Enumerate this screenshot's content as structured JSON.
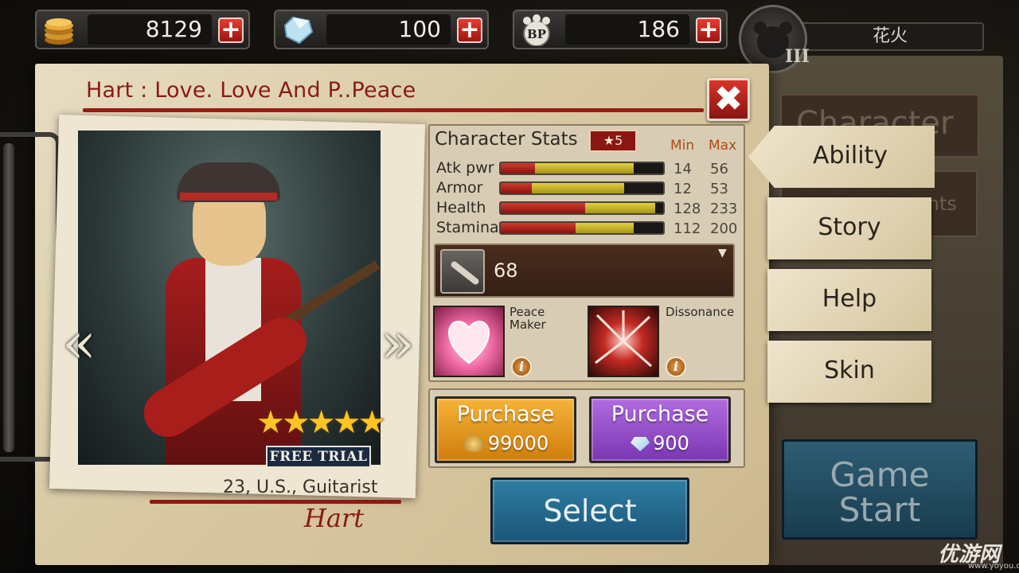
{
  "currency": {
    "gold": "8129",
    "gems": "100",
    "bp": "186",
    "bp_label": "BP"
  },
  "player": {
    "name": "花火",
    "rank": "III"
  },
  "title": "Hart : Love. Love And P..Peace",
  "card": {
    "stars": "★★★★★",
    "free_trial": "FREE TRIAL",
    "info": "23, U.S., Guitarist",
    "name": "Hart",
    "nav_left": "«",
    "nav_right": "»"
  },
  "stats": {
    "title": "Character Stats",
    "star_badge": "★5",
    "min_label": "Min",
    "max_label": "Max",
    "rows": [
      {
        "label": "Atk pwr",
        "min": "14",
        "max": "56",
        "min_frac": 0.21,
        "max_frac": 0.82
      },
      {
        "label": "Armor",
        "min": "12",
        "max": "53",
        "min_frac": 0.19,
        "max_frac": 0.76
      },
      {
        "label": "Health",
        "min": "128",
        "max": "233",
        "min_frac": 0.52,
        "max_frac": 0.95
      },
      {
        "label": "Stamina",
        "min": "112",
        "max": "200",
        "min_frac": 0.46,
        "max_frac": 0.82
      }
    ]
  },
  "weapon": {
    "value": "68",
    "dropdown": "▼"
  },
  "skills": [
    {
      "name_line1": "Peace",
      "name_line2": "Maker",
      "info": "i"
    },
    {
      "name_line1": "Dissonance",
      "name_line2": "",
      "info": "i"
    }
  ],
  "purchase": {
    "gold": {
      "label": "Purchase",
      "price": "99000"
    },
    "gem": {
      "label": "Purchase",
      "price": "900"
    }
  },
  "select_label": "Select",
  "close_label": "✖",
  "tabs": {
    "background_1": "Character",
    "background_2": "ents",
    "ability": "Ability",
    "story": "Story",
    "help": "Help",
    "skin": "Skin"
  },
  "game_start": {
    "line1": "Game",
    "line2": "Start"
  },
  "plus": "+",
  "watermark": {
    "text": "优游网",
    "url": "www.yoyou.com"
  },
  "colors": {
    "accent_red": "#8a1a14",
    "gold": "#cf7d0c",
    "purple": "#7a37b3",
    "blue": "#1b5478"
  }
}
